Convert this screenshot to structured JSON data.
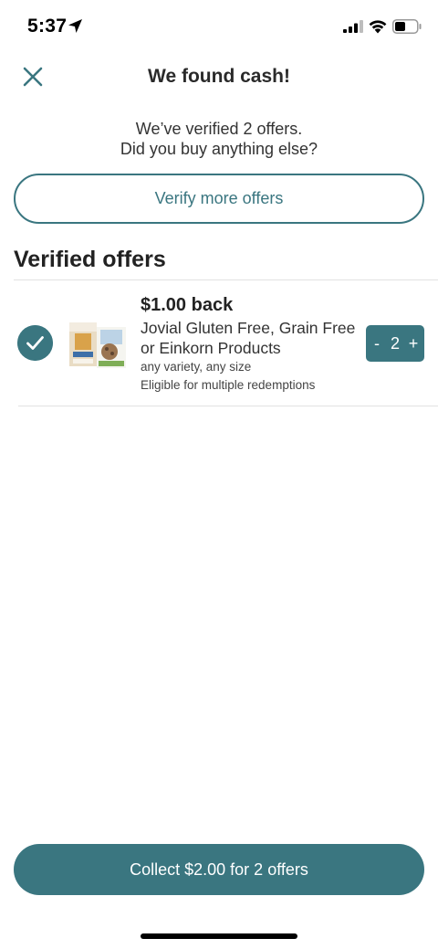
{
  "status_bar": {
    "time": "5:37",
    "icons": [
      "location-arrow-icon",
      "signal-icon",
      "wifi-icon",
      "battery-icon"
    ]
  },
  "header": {
    "title": "We found cash!",
    "close_icon": "close-icon"
  },
  "intro": {
    "line1": "We’ve verified 2 offers.",
    "line2": "Did you buy anything else?"
  },
  "verify_button": {
    "label": "Verify more offers"
  },
  "section": {
    "title": "Verified offers"
  },
  "offers": [
    {
      "amount": "$1.00 back",
      "name": "Jovial Gluten Free, Grain Free or Einkorn Products",
      "variety": "any variety, any size",
      "eligibility": "Eligible for multiple redemptions",
      "quantity": "2",
      "minus_label": "-",
      "plus_label": "+",
      "verified": true
    }
  ],
  "collect_button": {
    "label": "Collect $2.00 for 2 offers"
  },
  "colors": {
    "accent": "#3a7680",
    "text": "#222222",
    "divider": "#e2e2e2"
  }
}
